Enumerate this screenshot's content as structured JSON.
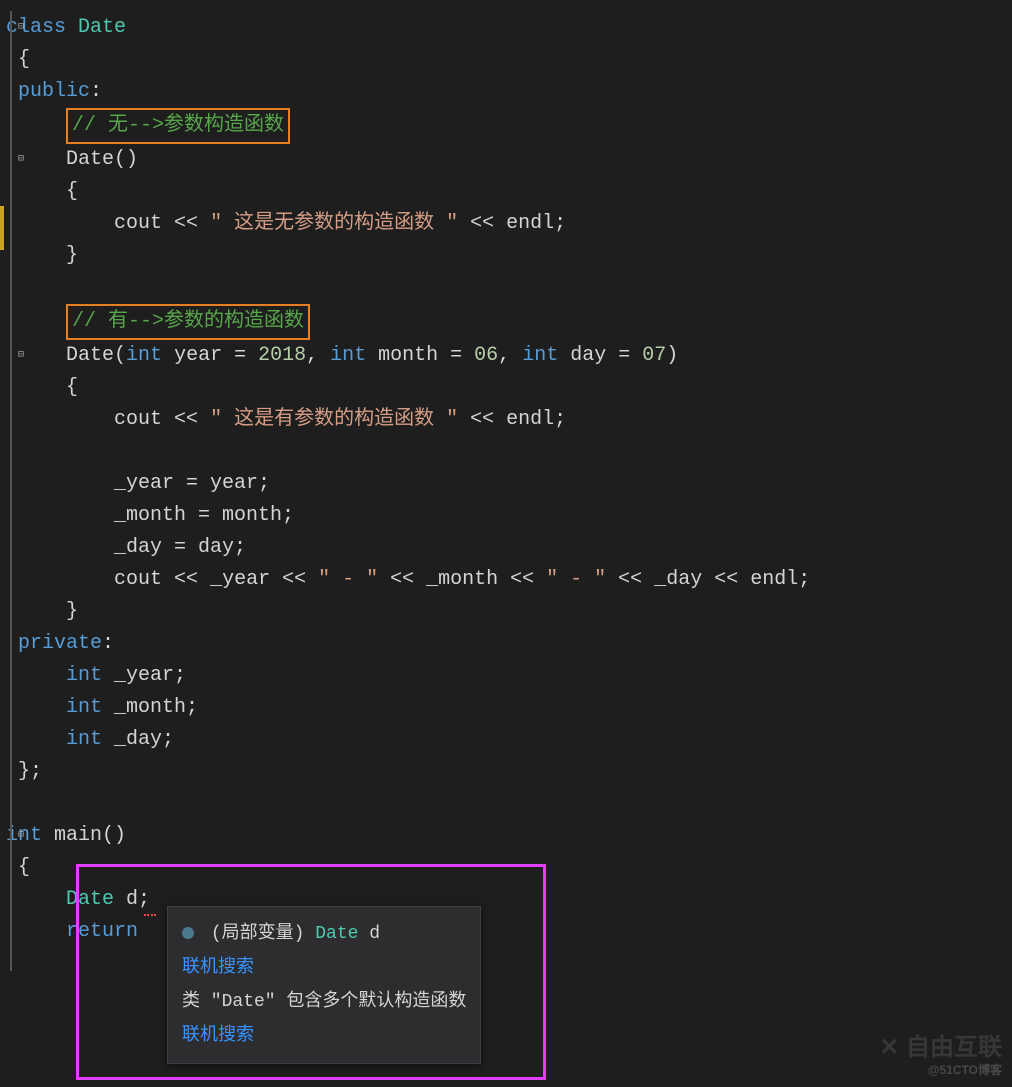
{
  "code": {
    "l1": {
      "class_kw": "class",
      "name": "Date"
    },
    "l2": "{",
    "l3": {
      "public_kw": "public",
      "colon": ":"
    },
    "l4_comment": "// 无-->参数构造函数",
    "l5": {
      "name": "Date",
      "parens": "()"
    },
    "l6": "    {",
    "l7": {
      "cout": "cout",
      "op1": " << ",
      "str": "\" 这是无参数的构造函数 \"",
      "op2": " << ",
      "endl": "endl",
      "semi": ";"
    },
    "l8": "    }",
    "l9_comment": "// 有-->参数的构造函数",
    "l10": {
      "name": "Date",
      "open": "(",
      "int1": "int",
      "p1": " year = ",
      "n1": "2018",
      "c1": ", ",
      "int2": "int",
      "p2": " month = ",
      "n2": "06",
      "c2": ", ",
      "int3": "int",
      "p3": " day = ",
      "n3": "07",
      "close": ")"
    },
    "l11": "    {",
    "l12": {
      "cout": "cout",
      "op1": " << ",
      "str": "\" 这是有参数的构造函数 \"",
      "op2": " << ",
      "endl": "endl",
      "semi": ";"
    },
    "l13": "",
    "l14": "        _year = year;",
    "l15": "        _month = month;",
    "l16": "        _day = day;",
    "l17": {
      "cout": "cout",
      "op1": " << ",
      "y": "_year",
      "op2": " << ",
      "s1": "\" - \"",
      "op3": " << ",
      "m": "_month",
      "op4": " << ",
      "s2": "\" - \"",
      "op5": " << ",
      "d": "_day",
      "op6": " << ",
      "endl": "endl",
      "semi": ";"
    },
    "l18": "    }",
    "l19": {
      "private_kw": "private",
      "colon": ":"
    },
    "l20": {
      "int_kw": "int",
      "name": " _year;"
    },
    "l21": {
      "int_kw": "int",
      "name": " _month;"
    },
    "l22": {
      "int_kw": "int",
      "name": " _day;"
    },
    "l23": "};",
    "l24": "",
    "l25": {
      "int_kw": "int",
      "main": " main",
      "parens": "()"
    },
    "l26": "{",
    "l27": {
      "type": "Date",
      "var": " d",
      "semi": ";"
    },
    "l28": {
      "return_kw": "return"
    }
  },
  "tooltip": {
    "row1_label": "(局部变量)",
    "row1_type": "Date",
    "row1_var": "d",
    "link1": "联机搜索",
    "error": "类 \"Date\" 包含多个默认构造函数",
    "link2": "联机搜索"
  },
  "watermark": {
    "main": "自由互联",
    "sub": "@51CTO博客"
  }
}
